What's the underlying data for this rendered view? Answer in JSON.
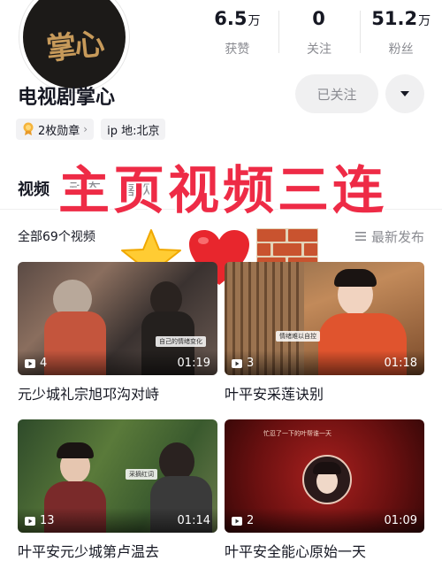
{
  "profile": {
    "avatar_text": "掌心",
    "name": "电视剧掌心",
    "follow_label": "已关注",
    "badges_label": "2枚勋章",
    "ip_label": "ip 地:北京"
  },
  "stats": [
    {
      "value": "6.5",
      "unit": "万",
      "label": "获赞"
    },
    {
      "value": "0",
      "unit": "",
      "label": "关注"
    },
    {
      "value": "51.2",
      "unit": "万",
      "label": "粉丝"
    }
  ],
  "tabs": [
    {
      "label": "视频",
      "active": true
    },
    {
      "label": "动态",
      "active": false
    },
    {
      "label": "喜欢",
      "active": false
    }
  ],
  "overlay_title": "主页视频三连",
  "list": {
    "count_label": "全部69个视频",
    "sort_label": "最新发布"
  },
  "videos": [
    {
      "title": "元少城礼宗旭邛沟对峙",
      "plays": "4",
      "duration": "01:19",
      "caption": "自己的情绪变化"
    },
    {
      "title": "叶平安采莲诀别",
      "plays": "3",
      "duration": "01:18",
      "caption": "情绪难以自控"
    },
    {
      "title": "叶平安元少城第卢温去",
      "plays": "13",
      "duration": "01:14",
      "caption": "采摘红词"
    },
    {
      "title": "叶平安全能心原始一天",
      "plays": "2",
      "duration": "01:09",
      "caption": "忙忍了一下的叶帮谁一天"
    }
  ],
  "colors": {
    "accent_red": "#ee2b46",
    "text_primary": "#161823",
    "text_secondary": "#8a8b91",
    "button_bg": "#f0f0f1"
  },
  "icons": [
    "medal-icon",
    "chevron-right-icon",
    "caret-down-icon",
    "sort-icon",
    "play-icon",
    "star-emoji",
    "heart-emoji",
    "brick-emoji"
  ]
}
